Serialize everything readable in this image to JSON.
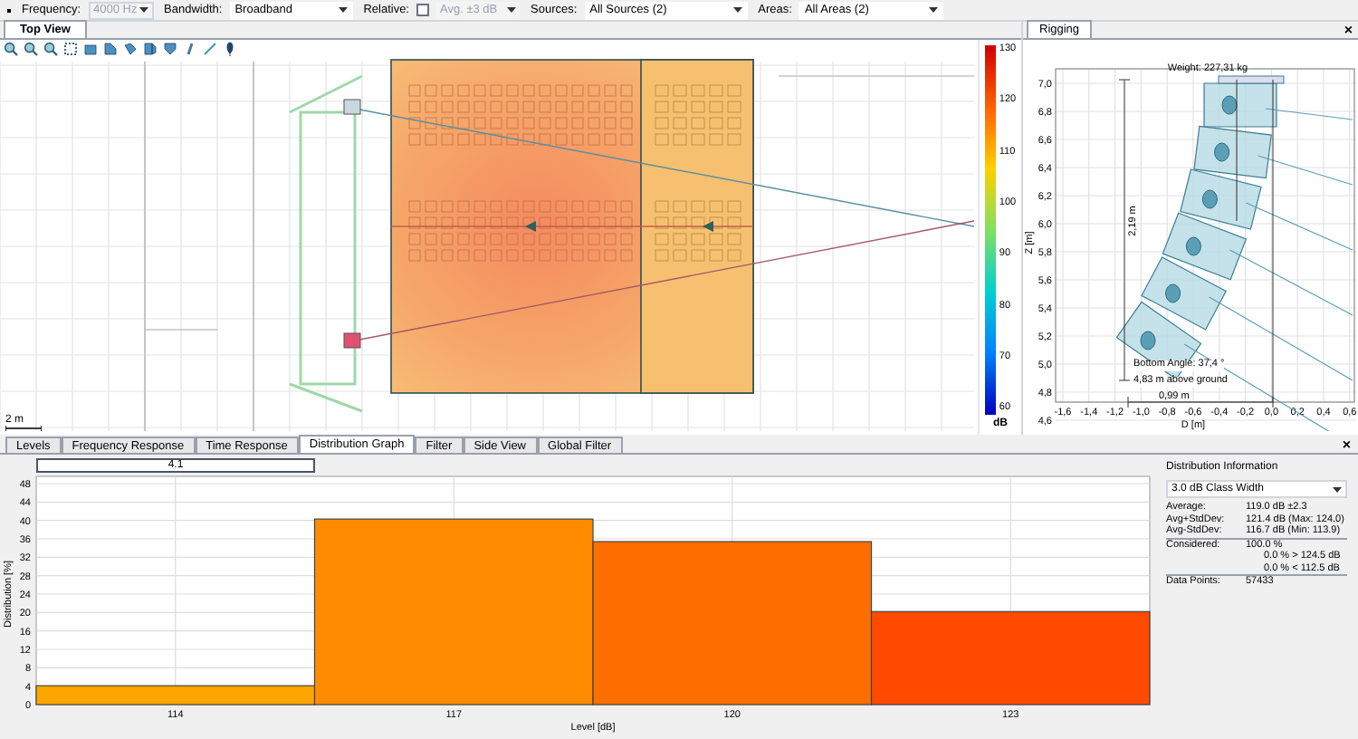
{
  "toolbar": {
    "frequency": {
      "label": "Frequency:",
      "value": "4000 Hz",
      "disabled": true
    },
    "bandwidth": {
      "label": "Bandwidth:",
      "value": "Broadband"
    },
    "relative": {
      "label": "Relative:",
      "checked": false,
      "value": "Avg. ±3 dB",
      "disabled": true
    },
    "sources": {
      "label": "Sources:",
      "value": "All Sources (2)"
    },
    "areas": {
      "label": "Areas:",
      "value": "All Areas (2)"
    }
  },
  "top_view": {
    "tab": "Top View",
    "scale_label": "2 m",
    "color_scale": {
      "unit": "dB",
      "ticks": [
        "130",
        "120",
        "110",
        "100",
        "90",
        "80",
        "70",
        "60"
      ]
    }
  },
  "rigging": {
    "tab": "Rigging",
    "close": "×",
    "weight": "Weight: 227,31 kg",
    "height": "2,19 m",
    "depth": "0,99 m",
    "bottom_angle": "Bottom Angle: 37,4 °",
    "above_ground": "4,83 m above ground",
    "ylabel": "Z [m]",
    "xlabel": "D [m]",
    "yticks": [
      "7,0",
      "6,8",
      "6,6",
      "6,4",
      "6,2",
      "6,0",
      "5,8",
      "5,6",
      "5,4",
      "5,2",
      "5,0",
      "4,8",
      "4,6"
    ],
    "xticks": [
      "-1,6",
      "-1,4",
      "-1,2",
      "-1,0",
      "-0,8",
      "-0,6",
      "-0,4",
      "-0,2",
      "0,0",
      "0,2",
      "0,4",
      "0,6"
    ]
  },
  "bottom_tabs": [
    {
      "label": "Levels",
      "selected": false
    },
    {
      "label": "Frequency Response",
      "selected": false
    },
    {
      "label": "Time Response",
      "selected": false
    },
    {
      "label": "Distribution Graph",
      "selected": true
    },
    {
      "label": "Filter",
      "selected": false
    },
    {
      "label": "Side View",
      "selected": false
    },
    {
      "label": "Global Filter",
      "selected": false
    }
  ],
  "bottom_close": "×",
  "distribution_graph": {
    "value_box": "4.1",
    "chart_data": {
      "type": "bar",
      "xlabel": "Level [dB]",
      "ylabel": "Distribution [%]",
      "grid": true,
      "stacked": true,
      "series": [
        {
          "name": "114",
          "color": "#ffa500",
          "values": [
            4.1,
            null,
            null,
            null
          ]
        },
        {
          "name": "117",
          "color": "#ff8c00",
          "values": [
            null,
            40.3,
            null,
            null
          ]
        },
        {
          "name": "120",
          "color": "#ff6e00",
          "values": [
            null,
            null,
            35.4,
            null
          ]
        },
        {
          "name": "123",
          "color": "#ff4a00",
          "values": [
            null,
            null,
            null,
            20.2
          ]
        }
      ],
      "ylim": [
        0,
        48
      ],
      "yticks": [
        0,
        4,
        8,
        12,
        16,
        20,
        24,
        28,
        32,
        36,
        40,
        44,
        48
      ]
    }
  },
  "distribution_info": {
    "title": "Distribution Information",
    "class_width": "3.0 dB Class Width",
    "rows": [
      {
        "label": "Average:",
        "values": [
          "119.0 dB ±2.3"
        ]
      },
      {
        "label": "Avg+StdDev:",
        "values": [
          "121.4 dB (Max: 124.0)"
        ]
      },
      {
        "label": "Avg-StdDev:",
        "values": [
          "116.7 dB (Min: 113.9)"
        ]
      },
      {
        "label": "Considered:",
        "values": [
          "100.0 %",
          "0.0 % > 124.5 dB",
          "0.0 % < 112.5 dB"
        ]
      },
      {
        "label": "Data Points:",
        "values": [
          "57433"
        ]
      }
    ]
  }
}
